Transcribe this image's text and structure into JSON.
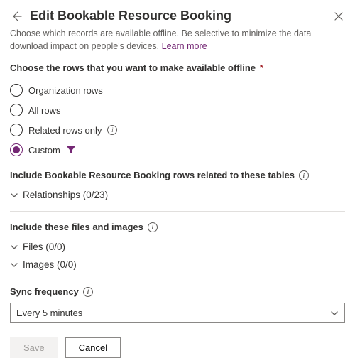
{
  "header": {
    "title": "Edit Bookable Resource Booking"
  },
  "intro": {
    "text": "Choose which records are available offline. Be selective to minimize the data download impact on people's devices. ",
    "link": "Learn more"
  },
  "rows_section": {
    "label": "Choose the rows that you want to make available offline",
    "options": {
      "org": "Organization rows",
      "all": "All rows",
      "related": "Related rows only",
      "custom": "Custom"
    }
  },
  "include_related": {
    "label": "Include Bookable Resource Booking rows related to these tables",
    "relationships_label": "Relationships (0/23)"
  },
  "files_section": {
    "label": "Include these files and images",
    "files_label": "Files (0/0)",
    "images_label": "Images (0/0)"
  },
  "sync": {
    "label": "Sync frequency",
    "value": "Every 5 minutes"
  },
  "footer": {
    "save": "Save",
    "cancel": "Cancel"
  }
}
